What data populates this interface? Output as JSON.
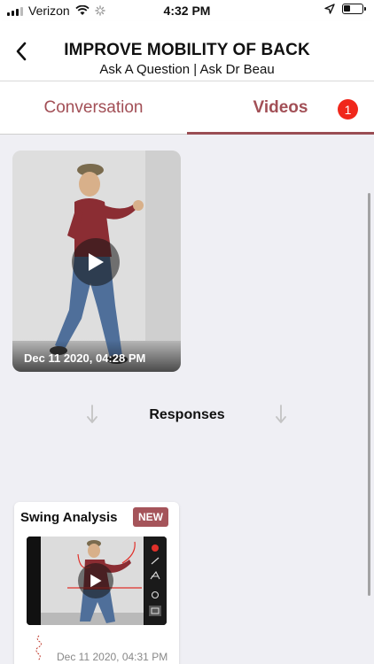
{
  "status_bar": {
    "carrier": "Verizon",
    "time": "4:32 PM"
  },
  "header": {
    "title": "IMPROVE MOBILITY OF BACK",
    "subtitle": "Ask A Question | Ask Dr Beau"
  },
  "tabs": [
    {
      "label": "Conversation",
      "active": false
    },
    {
      "label": "Videos",
      "active": true,
      "badge": "1"
    }
  ],
  "colors": {
    "accent": "#a24f56",
    "badge": "#f0271b",
    "new_badge": "#a5545a"
  },
  "video": {
    "date": "Dec 11 2020, 04:28 PM"
  },
  "responses": {
    "label": "Responses",
    "items": [
      {
        "title": "Swing Analysis",
        "badge": "NEW",
        "date": "Dec 11 2020, 04:31 PM"
      }
    ]
  }
}
